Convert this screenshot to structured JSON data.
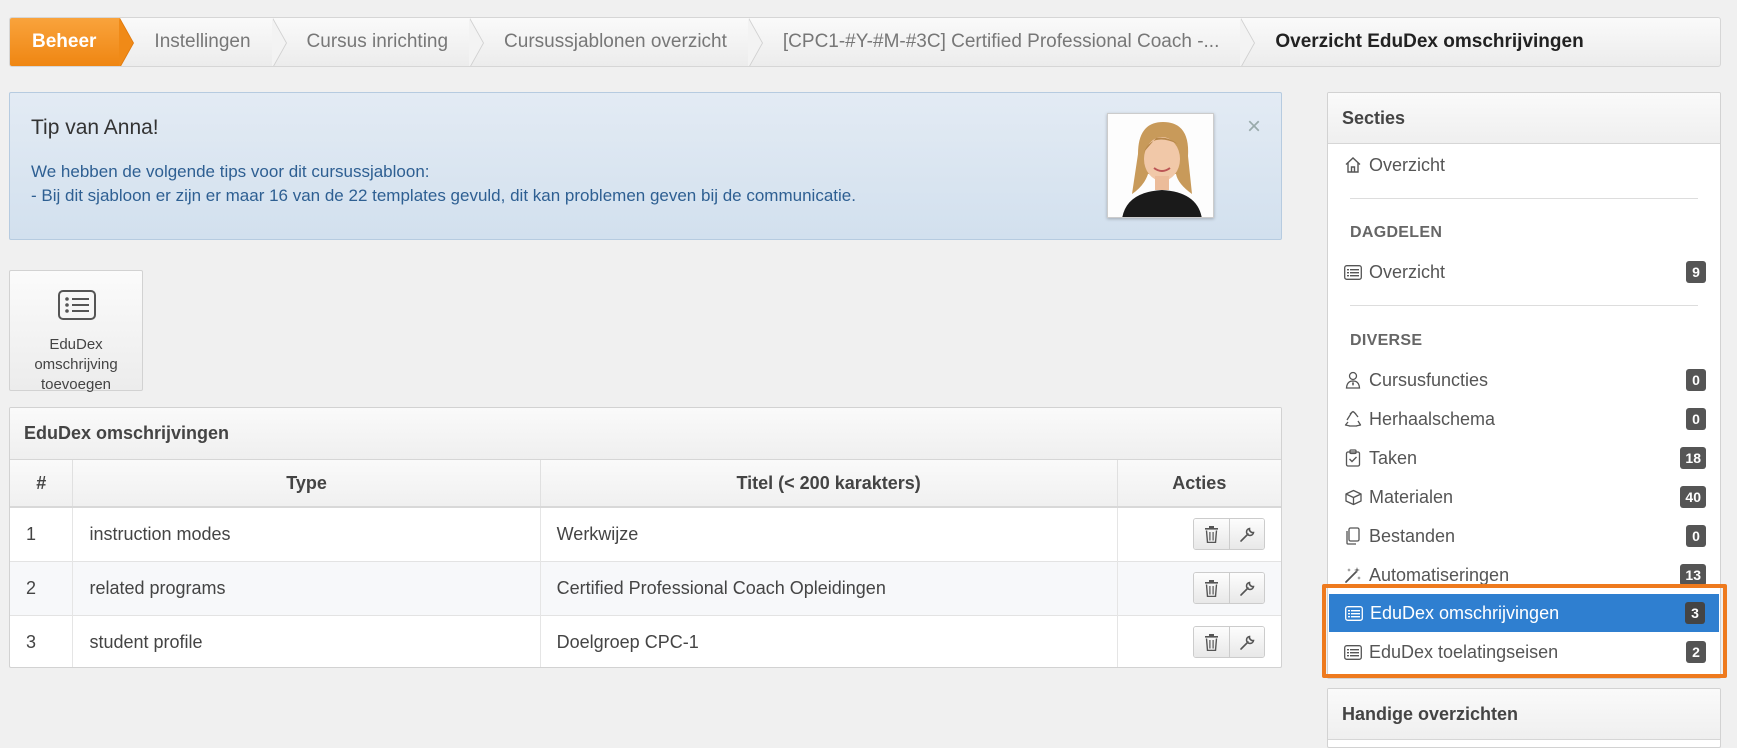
{
  "breadcrumb": {
    "items": [
      "Beheer",
      "Instellingen",
      "Cursus inrichting",
      "Cursussjablonen overzicht",
      "[CPC1-#Y-#M-#3C] Certified Professional Coach -...",
      "Overzicht EduDex omschrijvingen"
    ]
  },
  "tip": {
    "title": "Tip van Anna!",
    "line1": "We hebben de volgende tips voor dit cursussjabloon:",
    "line2": "- Bij dit sjabloon er zijn er maar 16 van de 22 templates gevuld, dit kan problemen geven bij de communicatie.",
    "close": "×"
  },
  "add_button": {
    "line1": "EduDex omschrijving",
    "line2": "toevoegen"
  },
  "table": {
    "title": "EduDex omschrijvingen",
    "headers": [
      "#",
      "Type",
      "Titel (< 200 karakters)",
      "Acties"
    ],
    "rows": [
      {
        "num": "1",
        "type": "instruction modes",
        "titel": "Werkwijze"
      },
      {
        "num": "2",
        "type": "related programs",
        "titel": "Certified Professional Coach Opleidingen"
      },
      {
        "num": "3",
        "type": "student profile",
        "titel": "Doelgroep CPC-1"
      }
    ]
  },
  "sidebar": {
    "title": "Secties",
    "overzicht": "Overzicht",
    "group_dagdelen": "DAGDELEN",
    "dagdelen_overzicht": {
      "label": "Overzicht",
      "count": "9"
    },
    "group_diverse": "DIVERSE",
    "items": [
      {
        "label": "Cursusfuncties",
        "count": "0",
        "icon": "user-tie-icon"
      },
      {
        "label": "Herhaalschema",
        "count": "0",
        "icon": "recycle-icon"
      },
      {
        "label": "Taken",
        "count": "18",
        "icon": "clipboard-icon"
      },
      {
        "label": "Materialen",
        "count": "40",
        "icon": "box-icon"
      },
      {
        "label": "Bestanden",
        "count": "0",
        "icon": "files-icon"
      },
      {
        "label": "Automatiseringen",
        "count": "13",
        "icon": "magic-wand-icon"
      },
      {
        "label": "EduDex omschrijvingen",
        "count": "3",
        "icon": "list-icon"
      },
      {
        "label": "EduDex toelatingseisen",
        "count": "2",
        "icon": "list-icon"
      }
    ],
    "handy_title": "Handige overzichten"
  },
  "colors": {
    "accent_orange": "#ef8612",
    "active_blue": "#2f7fd0",
    "highlight": "#ee7a1e"
  }
}
